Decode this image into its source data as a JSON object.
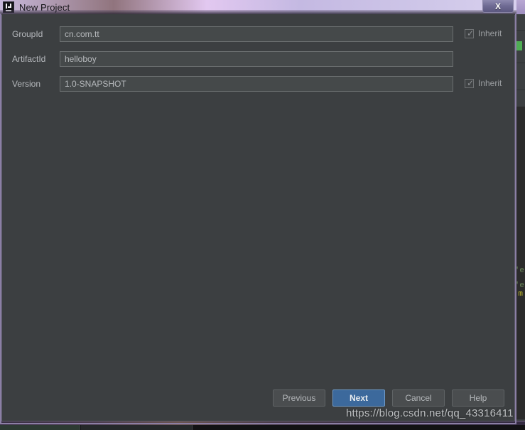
{
  "window": {
    "title": "New Project",
    "app_icon": "intellij-idea-icon",
    "close_label": "X"
  },
  "form": {
    "rows": [
      {
        "label": "GroupId",
        "value": "cn.com.tt",
        "placeholder": "",
        "inherit": {
          "label": "Inherit",
          "checked": true,
          "visible": true
        }
      },
      {
        "label": "ArtifactId",
        "value": "helloboy",
        "placeholder": "",
        "inherit": {
          "label": "",
          "checked": false,
          "visible": false
        }
      },
      {
        "label": "Version",
        "value": "1.0-SNAPSHOT",
        "placeholder": "",
        "inherit": {
          "label": "Inherit",
          "checked": true,
          "visible": true
        }
      }
    ],
    "checkbox_tick_glyph": "✓"
  },
  "buttons": {
    "previous": "Previous",
    "next": "Next",
    "cancel": "Cancel",
    "help": "Help"
  },
  "watermark": {
    "text": "https://blog.csdn.net/qq_43316411"
  },
  "background": {
    "code_fragment_1": "'e",
    "code_fragment_2": "'e",
    "code_fragment_3": "'m"
  },
  "colors": {
    "accent_button": "#3c699c",
    "dialog_background": "#3c3f41",
    "input_background": "#45494a",
    "titlebar_gradient_start": "#c9bfe0",
    "titlebar_gradient_end": "#cfc2e2",
    "label_text": "#b6b9bd",
    "window_border": "#8b7fa5",
    "ide_green_arrow": "#4fae54"
  }
}
